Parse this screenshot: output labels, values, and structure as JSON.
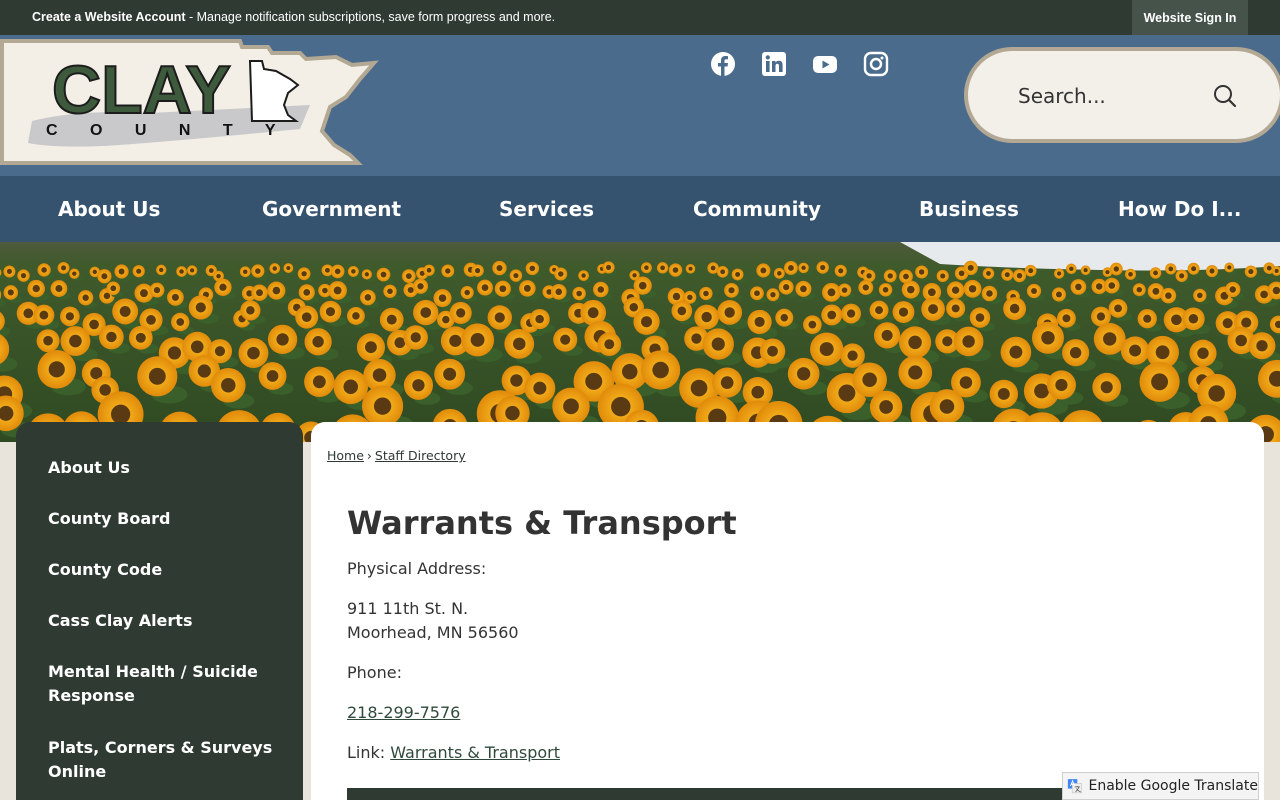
{
  "topbar": {
    "create_account": "Create a Website Account",
    "create_account_desc": " - Manage notification subscriptions, save form progress and more.",
    "sign_in": "Website Sign In"
  },
  "header": {
    "logo_text": "CLAY",
    "logo_subtext": "C O U N T Y",
    "social": [
      "facebook-icon",
      "linkedin-icon",
      "youtube-icon",
      "instagram-icon"
    ],
    "search_placeholder": "Search..."
  },
  "nav": {
    "items": [
      "About Us",
      "Government",
      "Services",
      "Community",
      "Business",
      "How Do I..."
    ]
  },
  "sidebar": {
    "items": [
      "About Us",
      "County Board",
      "County Code",
      "Cass Clay Alerts",
      "Mental Health / Suicide Response",
      "Plats, Corners & Surveys Online"
    ]
  },
  "breadcrumb": {
    "home": "Home",
    "separator": "›",
    "current": "Staff Directory"
  },
  "main": {
    "title": "Warrants & Transport",
    "physical_address_label": "Physical Address:",
    "address_line1": "911 11th St. N.",
    "address_line2": "Moorhead, MN 56560",
    "phone_label": "Phone:",
    "phone": "218-299-7576",
    "link_label": "Link: ",
    "link_text": "Warrants & Transport"
  },
  "translate": {
    "label": "Enable Google Translate"
  },
  "colors": {
    "topbar": "#2f3a33",
    "header": "#4a6b8c",
    "nav": "#35536f",
    "sidebar": "#2f3a33",
    "accent": "#b3a893"
  }
}
